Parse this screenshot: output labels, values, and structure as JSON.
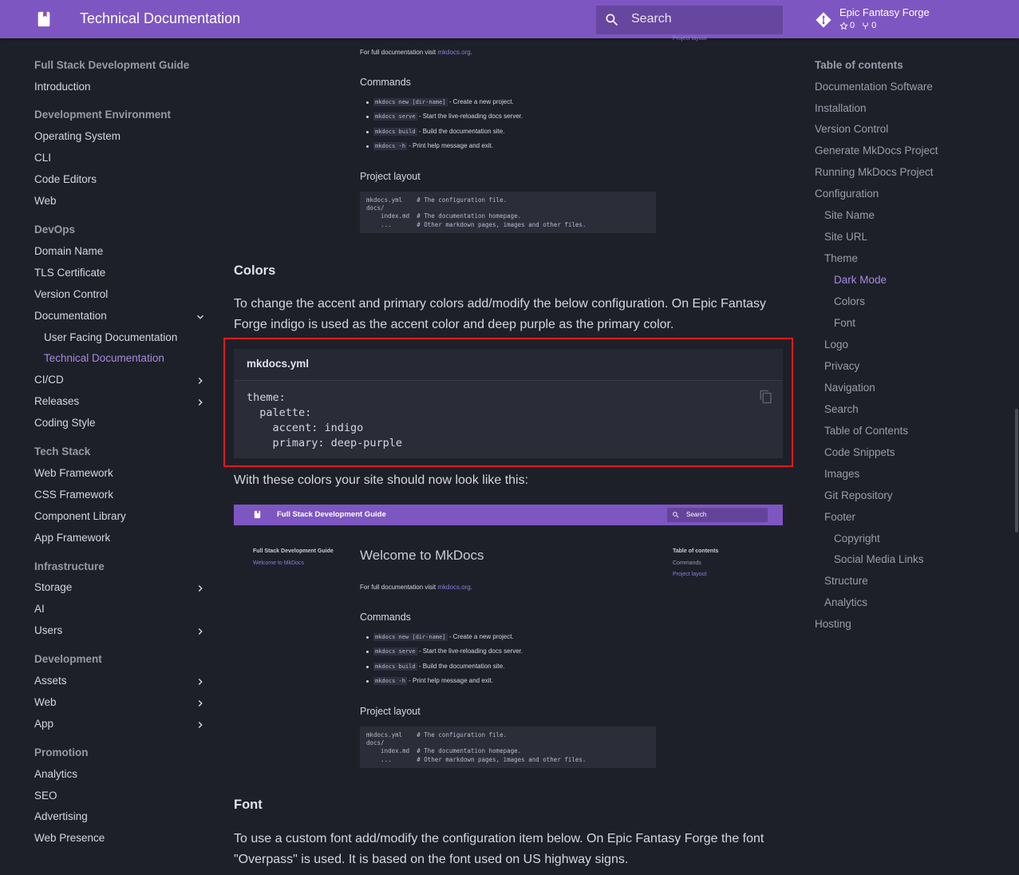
{
  "header": {
    "site_title": "Technical Documentation",
    "search_placeholder": "Search",
    "repo_name": "Epic Fantasy Forge",
    "stars": "0",
    "forks": "0"
  },
  "nav": {
    "title": "Full Stack Development Guide",
    "intro": "Introduction",
    "sections": {
      "dev_env": "Development Environment",
      "os": "Operating System",
      "cli": "CLI",
      "code_editors": "Code Editors",
      "web": "Web",
      "devops": "DevOps",
      "domain_name": "Domain Name",
      "tls": "TLS Certificate",
      "version_control": "Version Control",
      "documentation": "Documentation",
      "user_docs": "User Facing Documentation",
      "tech_docs": "Technical Documentation",
      "cicd": "CI/CD",
      "releases": "Releases",
      "coding_style": "Coding Style",
      "tech_stack": "Tech Stack",
      "web_framework": "Web Framework",
      "css_framework": "CSS Framework",
      "component_library": "Component Library",
      "app_framework": "App Framework",
      "infrastructure": "Infrastructure",
      "storage": "Storage",
      "ai": "AI",
      "users": "Users",
      "development": "Development",
      "assets": "Assets",
      "dev_web": "Web",
      "app": "App",
      "promotion": "Promotion",
      "analytics": "Analytics",
      "seo": "SEO",
      "advertising": "Advertising",
      "web_presence": "Web Presence"
    }
  },
  "toc": {
    "title": "Table of contents",
    "items": [
      "Documentation Software",
      "Installation",
      "Version Control",
      "Generate MkDocs Project",
      "Running MkDocs Project",
      "Configuration",
      "Site Name",
      "Site URL",
      "Theme",
      "Dark Mode",
      "Colors",
      "Font",
      "Logo",
      "Privacy",
      "Navigation",
      "Search",
      "Table of Contents",
      "Code Snippets",
      "Images",
      "Git Repository",
      "Footer",
      "Copyright",
      "Social Media Links",
      "Structure",
      "Analytics",
      "Hosting"
    ]
  },
  "content": {
    "colors_heading": "Colors",
    "colors_para": "To change the accent and primary colors add/modify the below configuration. On Epic Fantasy Forge indigo is used as the accent color and deep purple as the primary color.",
    "code_title": "mkdocs.yml",
    "code": "theme:\n  palette:\n    accent: indigo\n    primary: deep-purple",
    "after_code": "With these colors your site should now look like this:",
    "font_heading": "Font",
    "font_para": "To use a custom font add/modify the configuration item below. On Epic Fantasy Forge the font \"Overpass\" is used. It is based on the font used on US highway signs."
  },
  "mini": {
    "header_title": "Full Stack Development Guide",
    "search": "Search",
    "nav_title": "Full Stack Development Guide",
    "nav_active": "Welcome to MkDocs",
    "page_title": "Welcome to MkDocs",
    "full_docs": "For full documentation visit ",
    "full_docs_link": "mkdocs.org",
    "full_docs_end": ".",
    "commands": "Commands",
    "cmd1_code": "mkdocs new [dir-name]",
    "cmd1_text": " - Create a new project.",
    "cmd2_code": "mkdocs serve",
    "cmd2_text": " - Start the live-reloading docs server.",
    "cmd3_code": "mkdocs build",
    "cmd3_text": " - Build the documentation site.",
    "cmd4_code": "mkdocs -h",
    "cmd4_text": " - Print help message and exit.",
    "project_layout": "Project layout",
    "layout_code": "mkdocs.yml    # The configuration file.\ndocs/\n    index.md  # The documentation homepage.\n    ...       # Other markdown pages, images and other files.",
    "toc_title": "Table of contents",
    "toc_commands": "Commands",
    "toc_layout": "Project layout"
  },
  "colors": {
    "primary": "#7e56c2",
    "accent": "#a68bdf",
    "highlight_border": "#e01b1b"
  }
}
